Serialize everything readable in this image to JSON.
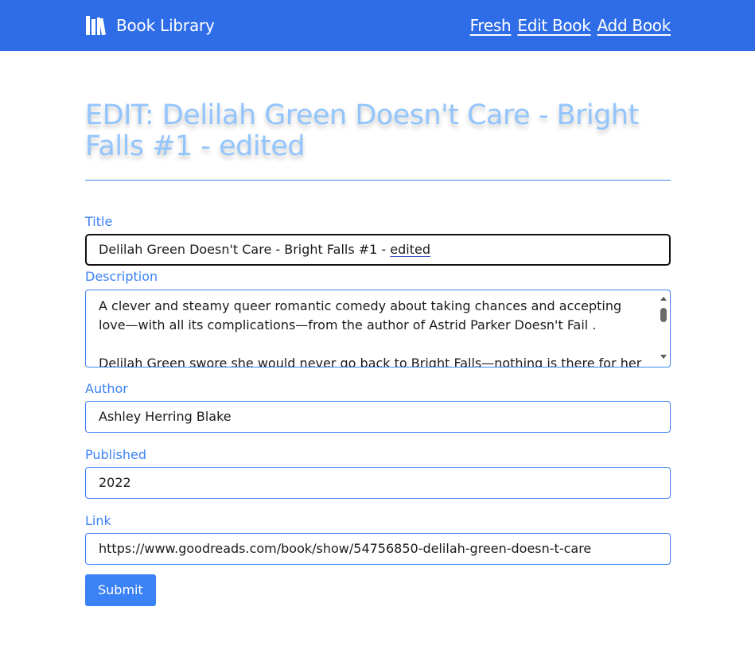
{
  "nav": {
    "brand": "Book Library",
    "brand_icon": "books-icon",
    "links": [
      "Fresh",
      "Edit Book",
      "Add Book"
    ]
  },
  "page": {
    "title": "EDIT: Delilah Green Doesn't Care - Bright Falls #1 - edited"
  },
  "form": {
    "title_label": "Title",
    "title_value_main": "Delilah Green Doesn't Care - Bright Falls #1 - ",
    "title_value_edited": "edited",
    "description_label": "Description",
    "description_p1": "A clever and steamy queer romantic comedy about taking chances and accepting love—with all its complications—from the author of Astrid Parker Doesn't Fail .",
    "description_p2": "Delilah Green swore she would never go back to Bright Falls—nothing is there for her but",
    "author_label": "Author",
    "author_value": "Ashley Herring Blake",
    "published_label": "Published",
    "published_value": "2022",
    "link_label": "Link",
    "link_value": "https://www.goodreads.com/book/show/54756850-delilah-green-doesn-t-care",
    "submit_label": "Submit"
  },
  "colors": {
    "navbar": "#2f6de8",
    "accent": "#3b82f6",
    "title": "#93c5fd"
  }
}
